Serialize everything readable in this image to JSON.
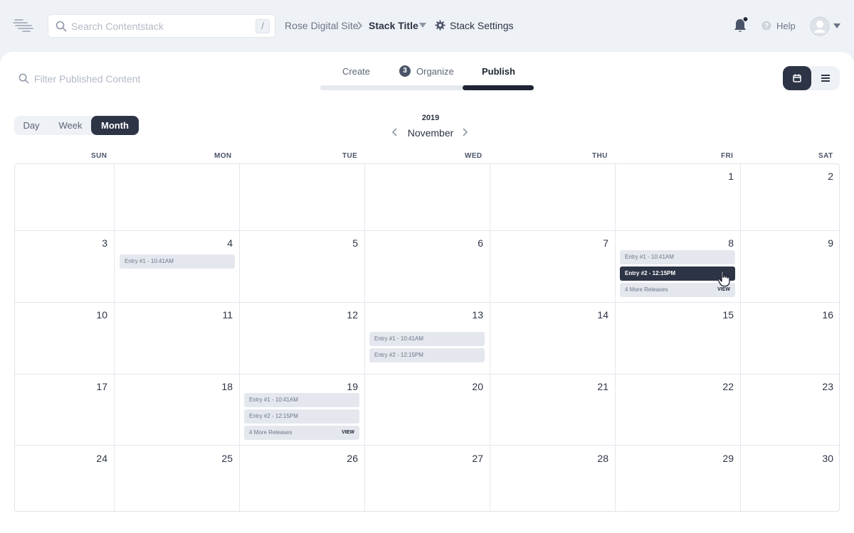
{
  "header": {
    "search_placeholder": "Search Contentstack",
    "shortcut_key": "/",
    "breadcrumb_site": "Rose Digital Site",
    "stack_title": "Stack Title",
    "settings_label": "Stack Settings",
    "help_label": "Help"
  },
  "toolbar": {
    "filter_placeholder": "Filter Published Content",
    "tabs": [
      {
        "label": "Create"
      },
      {
        "label": "Organize",
        "badge": "3"
      },
      {
        "label": "Publish"
      }
    ],
    "active_tab": "Publish"
  },
  "calendar": {
    "range_buttons": [
      "Day",
      "Week",
      "Month"
    ],
    "active_range": "Month",
    "year": "2019",
    "month": "November",
    "weekdays": [
      "SUN",
      "MON",
      "TUE",
      "WED",
      "THU",
      "FRI",
      "SAT"
    ],
    "weeks": [
      [
        "",
        "",
        "",
        "",
        "",
        "1",
        "2"
      ],
      [
        "3",
        "4",
        "5",
        "6",
        "7",
        "8",
        "9"
      ],
      [
        "10",
        "11",
        "12",
        "13",
        "14",
        "15",
        "16"
      ],
      [
        "17",
        "18",
        "19",
        "20",
        "21",
        "22",
        "23"
      ],
      [
        "24",
        "25",
        "26",
        "27",
        "28",
        "29",
        "30"
      ]
    ],
    "events": {
      "nov4": [
        "Entry #1 - 10:41AM"
      ],
      "nov8": [
        "Entry #1 - 10:41AM",
        "Entry #2 - 12:15PM"
      ],
      "nov8_more": "4 More Releases",
      "nov13": [
        "Entry #1 - 10:41AM",
        "Entry #2 - 12:15PM"
      ],
      "nov19": [
        "Entry #1 - 10:41AM",
        "Entry #2 - 12:15PM"
      ],
      "nov19_more": "4 More Releases"
    },
    "view_label": "VIEW"
  }
}
